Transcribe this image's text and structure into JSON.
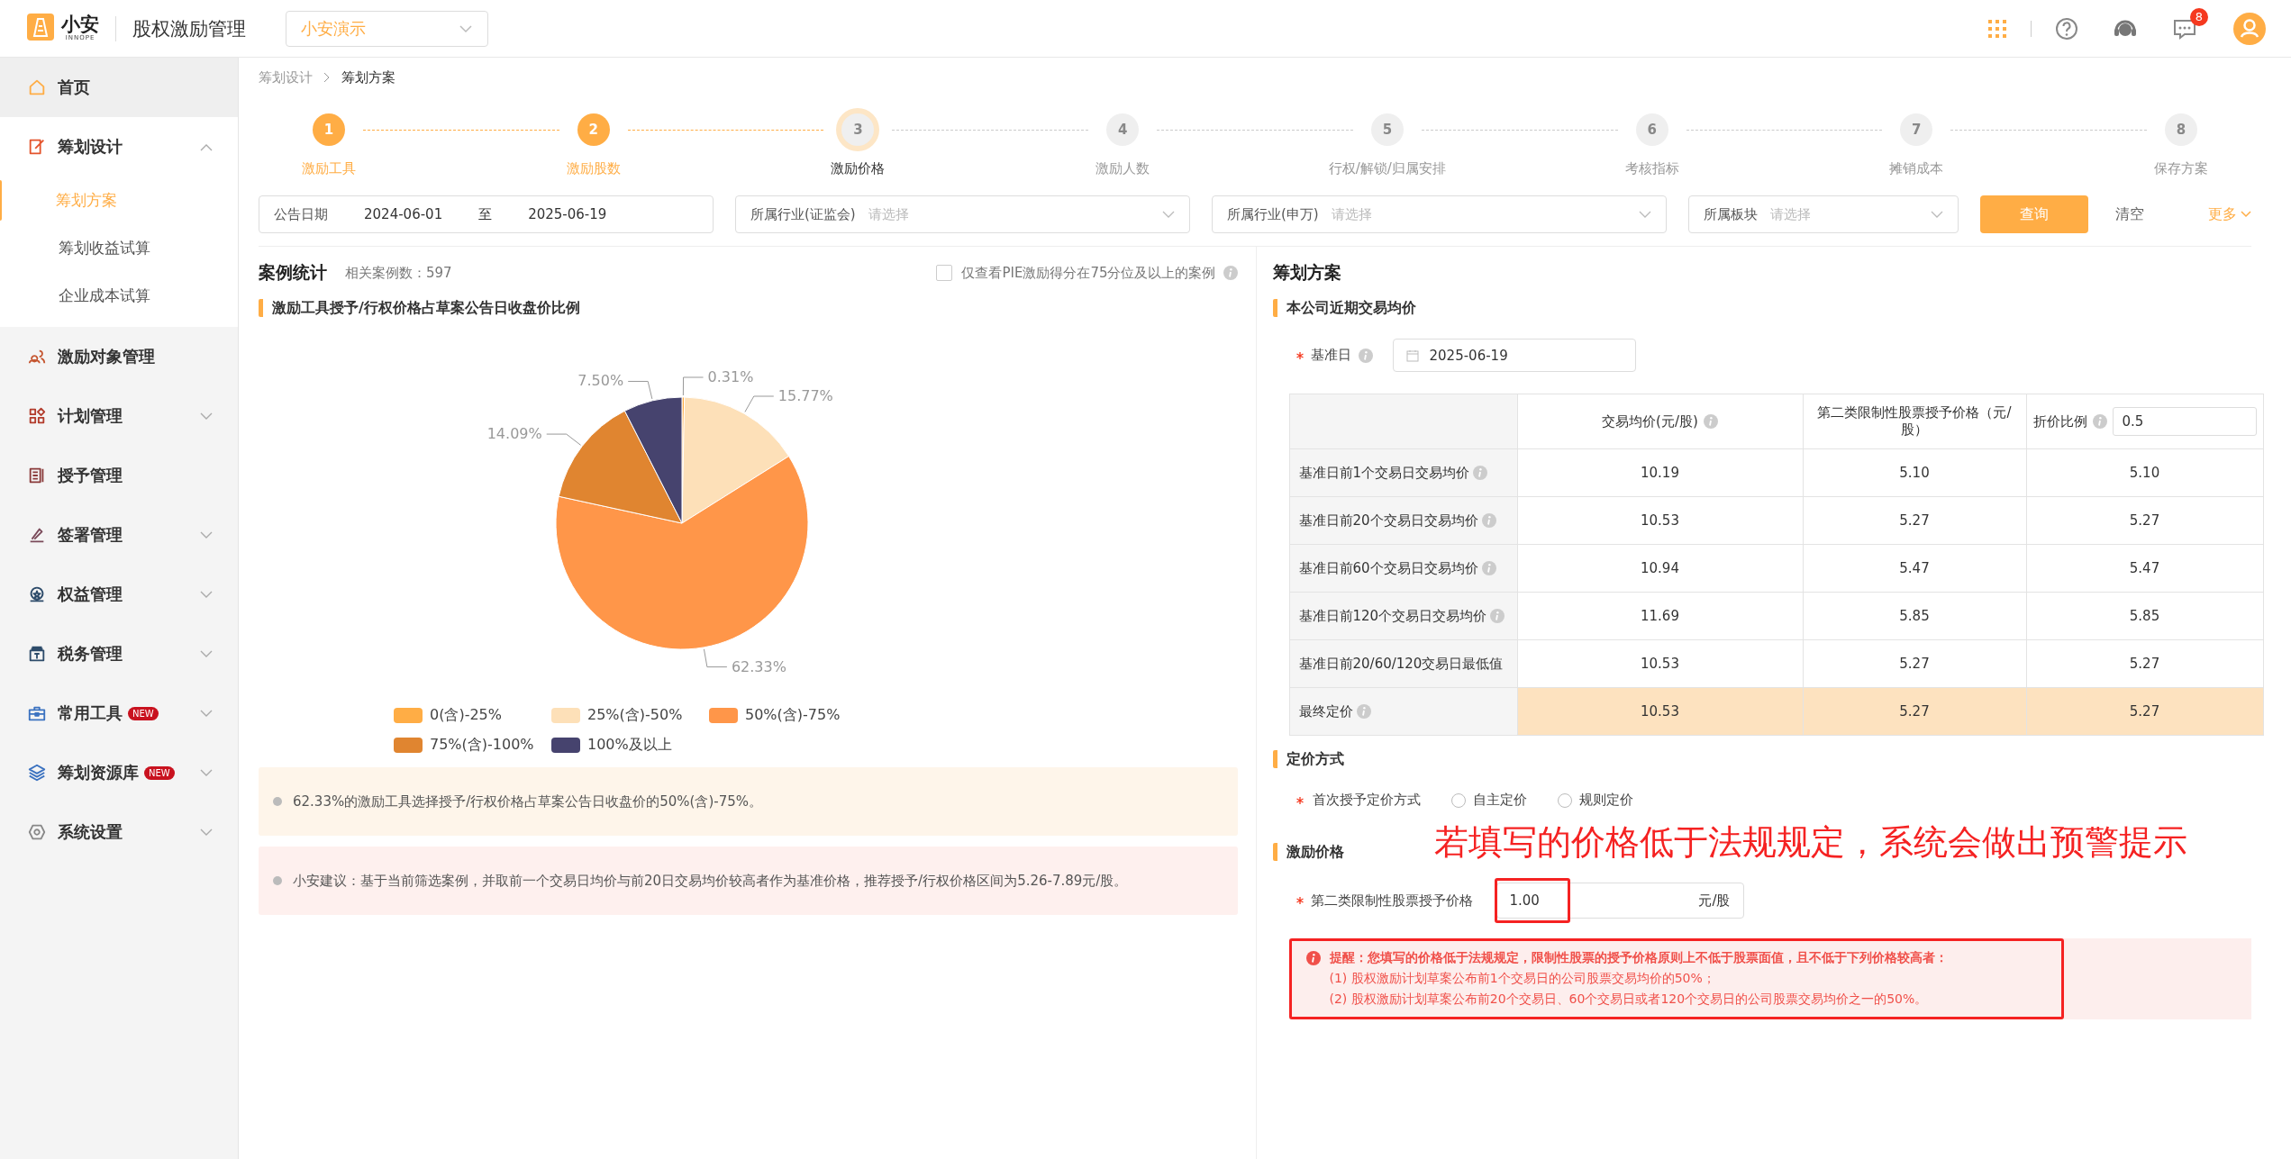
{
  "header": {
    "brand": "小安",
    "brand_sub": "INNOPE",
    "app_title": "股权激励管理",
    "company_select": "小安演示",
    "notification_count": "8"
  },
  "sidebar": {
    "items": [
      {
        "label": "首页",
        "expandable": false
      },
      {
        "label": "筹划设计",
        "expanded": true,
        "expandable": true,
        "children": [
          {
            "label": "筹划方案",
            "selected": true
          },
          {
            "label": "筹划收益试算",
            "selected": false
          },
          {
            "label": "企业成本试算",
            "selected": false
          }
        ]
      },
      {
        "label": "激励对象管理",
        "expandable": false
      },
      {
        "label": "计划管理",
        "expanded": false,
        "expandable": true
      },
      {
        "label": "授予管理",
        "expandable": false
      },
      {
        "label": "签署管理",
        "expanded": false,
        "expandable": true
      },
      {
        "label": "权益管理",
        "expanded": false,
        "expandable": true
      },
      {
        "label": "税务管理",
        "expanded": false,
        "expandable": true
      },
      {
        "label": "常用工具",
        "badge": "NEW",
        "expanded": false,
        "expandable": true
      },
      {
        "label": "筹划资源库",
        "badge": "NEW",
        "expanded": false,
        "expandable": true
      },
      {
        "label": "系统设置",
        "expanded": false,
        "expandable": true
      }
    ]
  },
  "breadcrumb": [
    "筹划设计",
    "筹划方案"
  ],
  "steps": [
    {
      "number": "1",
      "label": "激励工具",
      "done": true,
      "selected": false
    },
    {
      "number": "2",
      "label": "激励股数",
      "done": true,
      "selected": false
    },
    {
      "number": "3",
      "label": "激励价格",
      "done": false,
      "selected": true
    },
    {
      "number": "4",
      "label": "激励人数",
      "done": false,
      "selected": false
    },
    {
      "number": "5",
      "label": "行权/解锁/归属安排",
      "done": false,
      "selected": false
    },
    {
      "number": "6",
      "label": "考核指标",
      "done": false,
      "selected": false
    },
    {
      "number": "7",
      "label": "摊销成本",
      "done": false,
      "selected": false
    },
    {
      "number": "8",
      "label": "保存方案",
      "done": false,
      "selected": false
    }
  ],
  "filters": {
    "date_label": "公告日期",
    "date_from": "2024-06-01",
    "date_sep": "至",
    "date_to": "2025-06-19",
    "selects": [
      {
        "label": "所属行业(证监会)",
        "placeholder": "请选择"
      },
      {
        "label": "所属行业(申万)",
        "placeholder": "请选择"
      },
      {
        "label": "所属板块",
        "placeholder": "请选择"
      }
    ],
    "query_button": "查询",
    "clear_button": "清空",
    "more_link": "更多"
  },
  "case_stats": {
    "title": "案例统计",
    "count": "相关案例数：597",
    "filter_checkbox": {
      "label": "仅查看PIE激励得分在75分位及以上的案例",
      "checked": false
    },
    "chart_title": "激励工具授予/行权价格占草案公告日收盘价比例",
    "chart_data": {
      "type": "pie",
      "categories": [
        "0(含)-25%",
        "25%(含)-50%",
        "50%(含)-75%",
        "75%(含)-100%",
        "100%及以上"
      ],
      "values": [
        0.31,
        15.77,
        62.33,
        14.09,
        7.5
      ],
      "colors": [
        "#ffad45",
        "#fde0b8",
        "#ff9649",
        "#e08530",
        "#46436e"
      ],
      "data_labels": true,
      "legend": "bottom",
      "value_labels": [
        "0.31%",
        "15.77%",
        "62.33%",
        "14.09%",
        "7.50%"
      ]
    },
    "notes": [
      {
        "text": "62.33%的激励工具选择授予/行权价格占草案公告日收盘价的50%(含)-75%。",
        "color": "#fef5ea"
      },
      {
        "text": "小安建议：基于当前筛选案例，并取前一个交易日均价与前20日交易均价较高者作为基准价格，推荐授予/行权价格区间为5.26-7.89元/股。",
        "color": "#fef0ee"
      }
    ]
  },
  "plan": {
    "title": "筹划方案",
    "section_trading": "本公司近期交易均价",
    "base_date_label": "基准日",
    "base_date": "2025-06-19",
    "table": {
      "columns": [
        {
          "info": false
        },
        {
          "label": "交易均价(元/股)",
          "info": true
        },
        {
          "label": "第二类限制性股票授予价格（元/股）",
          "info": false
        },
        {
          "label": "折价比例",
          "info": true,
          "input": "0.5"
        }
      ],
      "rows": [
        {
          "label": "基准日前1个交易日交易均价",
          "info": true,
          "final": false,
          "values": [
            "10.19",
            "5.10",
            "5.10"
          ]
        },
        {
          "label": "基准日前20个交易日交易均价",
          "info": true,
          "final": false,
          "values": [
            "10.53",
            "5.27",
            "5.27"
          ]
        },
        {
          "label": "基准日前60个交易日交易均价",
          "info": true,
          "final": false,
          "values": [
            "10.94",
            "5.47",
            "5.47"
          ]
        },
        {
          "label": "基准日前120个交易日交易均价",
          "info": true,
          "final": false,
          "values": [
            "11.69",
            "5.85",
            "5.85"
          ]
        },
        {
          "label": "基准日前20/60/120交易日最低值",
          "info": false,
          "final": false,
          "values": [
            "10.53",
            "5.27",
            "5.27"
          ]
        },
        {
          "label": "最终定价",
          "info": true,
          "final": true,
          "values": [
            "10.53",
            "5.27",
            "5.27"
          ]
        }
      ]
    },
    "section_pricing": "定价方式",
    "pricing_label": "首次授予定价方式",
    "pricing_options": [
      {
        "label": "自主定价",
        "selected": false
      },
      {
        "label": "规则定价",
        "selected": false
      }
    ],
    "section_price": "激励价格",
    "price_label": "第二类限制性股票授予价格",
    "price_value": "1.00",
    "price_unit": "元/股",
    "warning": {
      "title": "提醒：您填写的价格低于法规规定，限制性股票的授予价格原则上不低于股票面值，且不低于下列价格较高者：",
      "lines": [
        "(1) 股权激励计划草案公布前1个交易日的公司股票交易均价的50%；",
        "(2) 股权激励计划草案公布前20个交易日、60个交易日或者120个交易日的公司股票交易均价之一的50%。"
      ]
    },
    "callout": "若填写的价格低于法规规定，系统会做出预警提示"
  }
}
